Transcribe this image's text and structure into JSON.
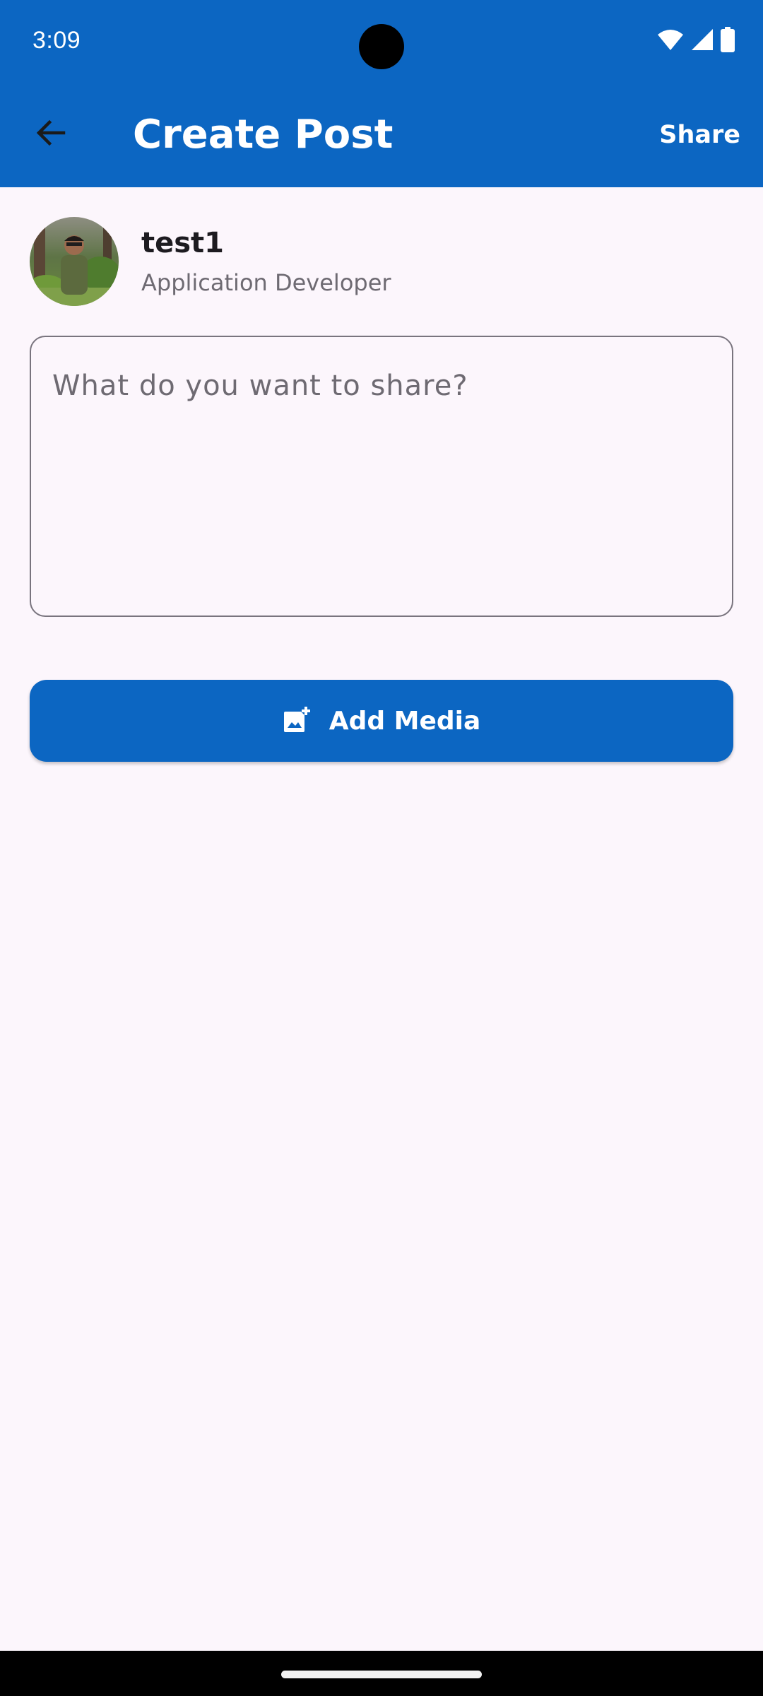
{
  "status_bar": {
    "time": "3:09",
    "icons": [
      "wifi-icon",
      "cellular-signal-icon",
      "battery-icon"
    ]
  },
  "app_bar": {
    "back_icon": "arrow-back-icon",
    "title": "Create Post",
    "share_label": "Share"
  },
  "profile": {
    "name": "test1",
    "role": "Application Developer"
  },
  "post_input": {
    "placeholder": "What do you want to share?",
    "value": ""
  },
  "add_media": {
    "icon": "add-photo-icon",
    "label": "Add Media"
  },
  "colors": {
    "primary": "#0C66C2",
    "background": "#FCF6FC",
    "text_primary": "#1D1B20",
    "text_secondary": "#6E6A72",
    "outline": "#79747E"
  }
}
